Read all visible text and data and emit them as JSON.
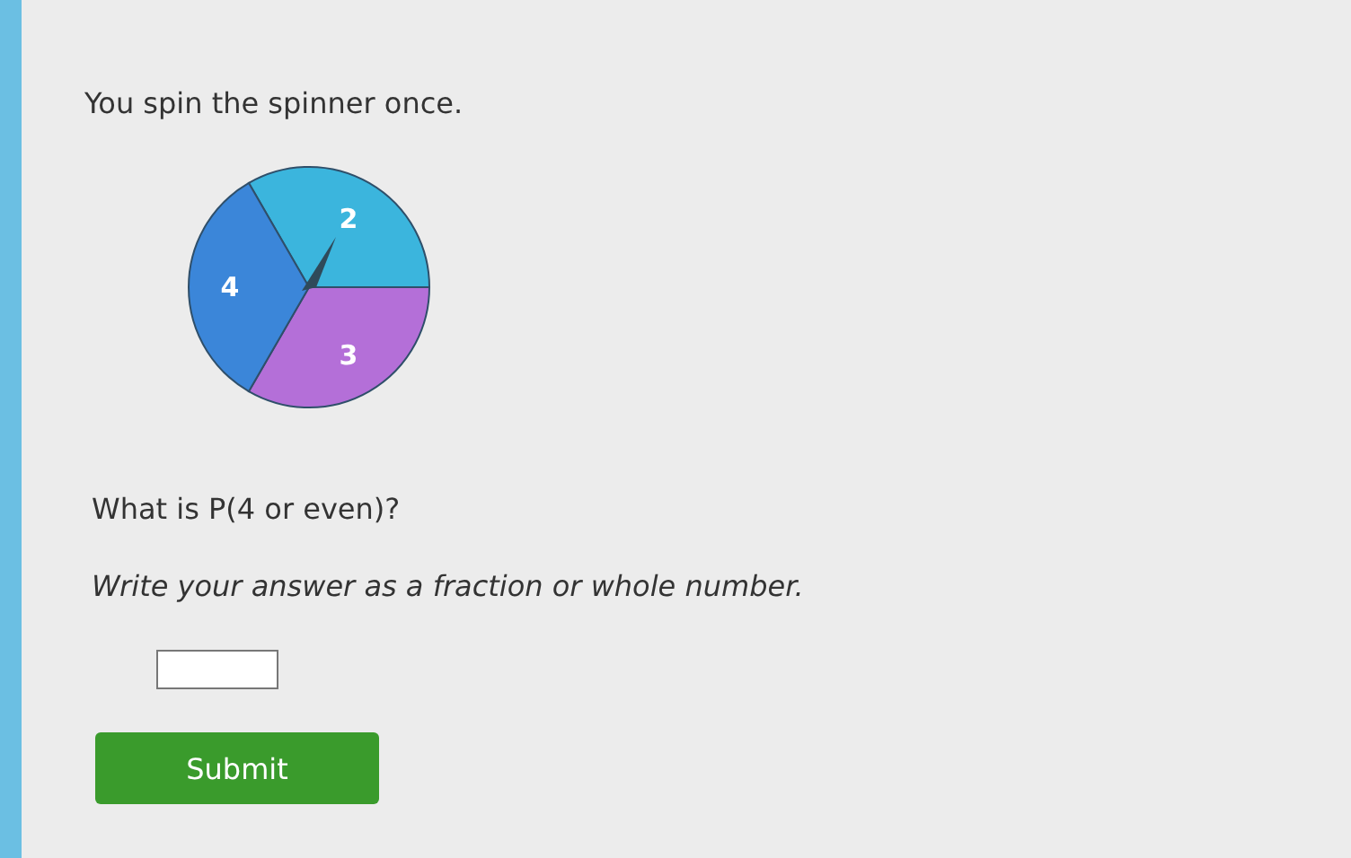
{
  "prompt": "You spin the spinner once.",
  "spinner": {
    "sectors": [
      {
        "label": "2",
        "color": "#3bb5dd"
      },
      {
        "label": "3",
        "color": "#b46fd8"
      },
      {
        "label": "4",
        "color": "#3b86d9"
      }
    ]
  },
  "question": "What is P(4 or even)?",
  "instruction": "Write your answer as a fraction or whole number.",
  "submit": "Submit"
}
